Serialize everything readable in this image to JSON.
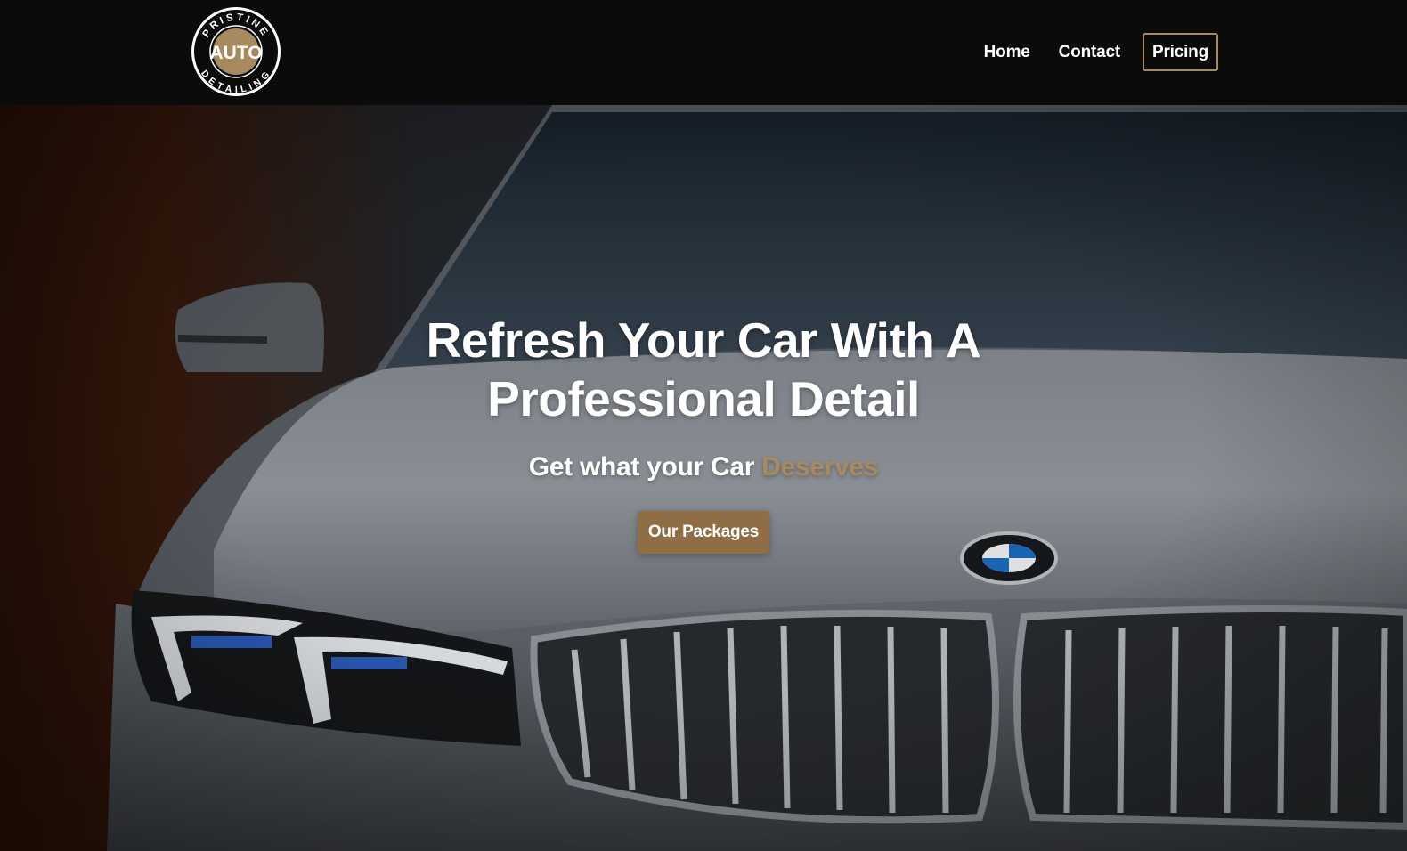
{
  "brand": {
    "logo_top": "PRISTINE",
    "logo_center": "AUTO",
    "logo_bottom": "DETAILING",
    "gold": "#a88a5f",
    "dark": "#0b0b0b"
  },
  "nav": {
    "home": "Home",
    "contact": "Contact",
    "pricing": "Pricing"
  },
  "hero": {
    "headline": "Refresh Your Car With A Professional Detail",
    "subline_prefix": "Get what your Car ",
    "subline_accent": "Deserves",
    "cta_label": "Our Packages",
    "cta_color": "#8f6e45",
    "background_image": "car-front-icon"
  }
}
